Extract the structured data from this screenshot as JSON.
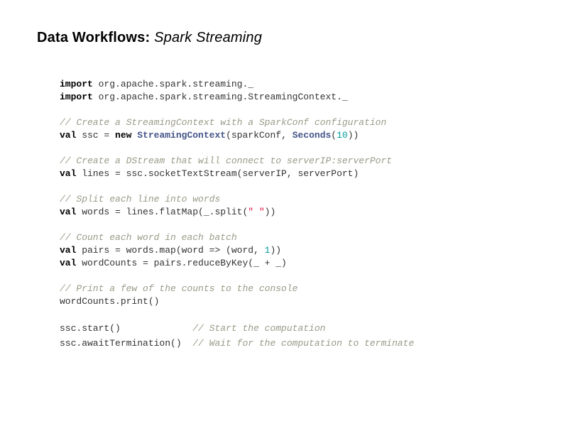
{
  "title": {
    "main": "Data Workflows:",
    "sub": "Spark Streaming"
  },
  "code": {
    "lines": [
      [
        {
          "t": "kw",
          "v": "import"
        },
        {
          "t": "plain",
          "v": " org.apache.spark.streaming._"
        }
      ],
      [
        {
          "t": "kw",
          "v": "import"
        },
        {
          "t": "plain",
          "v": " org.apache.spark.streaming.StreamingContext._"
        }
      ],
      null,
      [
        {
          "t": "cmt",
          "v": "// Create a StreamingContext with a SparkConf configuration"
        }
      ],
      [
        {
          "t": "kw",
          "v": "val"
        },
        {
          "t": "plain",
          "v": " ssc = "
        },
        {
          "t": "kw",
          "v": "new"
        },
        {
          "t": "plain",
          "v": " "
        },
        {
          "t": "type",
          "v": "StreamingContext"
        },
        {
          "t": "plain",
          "v": "(sparkConf, "
        },
        {
          "t": "type",
          "v": "Seconds"
        },
        {
          "t": "plain",
          "v": "("
        },
        {
          "t": "num",
          "v": "10"
        },
        {
          "t": "plain",
          "v": "))"
        }
      ],
      null,
      [
        {
          "t": "cmt",
          "v": "// Create a DStream that will connect to serverIP:serverPort"
        }
      ],
      [
        {
          "t": "kw",
          "v": "val"
        },
        {
          "t": "plain",
          "v": " lines = ssc.socketTextStream(serverIP, serverPort)"
        }
      ],
      null,
      [
        {
          "t": "cmt",
          "v": "// Split each line into words"
        }
      ],
      [
        {
          "t": "kw",
          "v": "val"
        },
        {
          "t": "plain",
          "v": " words = lines.flatMap(_.split("
        },
        {
          "t": "str",
          "v": "\" \""
        },
        {
          "t": "plain",
          "v": "))"
        }
      ],
      null,
      [
        {
          "t": "cmt",
          "v": "// Count each word in each batch"
        }
      ],
      [
        {
          "t": "kw",
          "v": "val"
        },
        {
          "t": "plain",
          "v": " pairs = words.map(word => (word, "
        },
        {
          "t": "num",
          "v": "1"
        },
        {
          "t": "plain",
          "v": "))"
        }
      ],
      [
        {
          "t": "kw",
          "v": "val"
        },
        {
          "t": "plain",
          "v": " wordCounts = pairs.reduceByKey(_ + _)"
        }
      ],
      null,
      [
        {
          "t": "cmt",
          "v": "// Print a few of the counts to the console"
        }
      ],
      [
        {
          "t": "plain",
          "v": "wordCounts.print()"
        }
      ],
      null,
      [
        {
          "t": "plain",
          "v": "ssc.start()             "
        },
        {
          "t": "cmt",
          "v": "// Start the computation"
        }
      ],
      [
        {
          "t": "plain",
          "v": "ssc.awaitTermination()  "
        },
        {
          "t": "cmt",
          "v": "// Wait for the computation to terminate"
        }
      ]
    ]
  },
  "colors": {
    "keyword": "#000000",
    "type": "#445588",
    "number": "#009999",
    "string": "#dd1144",
    "comment": "#999988",
    "plain": "#333333"
  }
}
